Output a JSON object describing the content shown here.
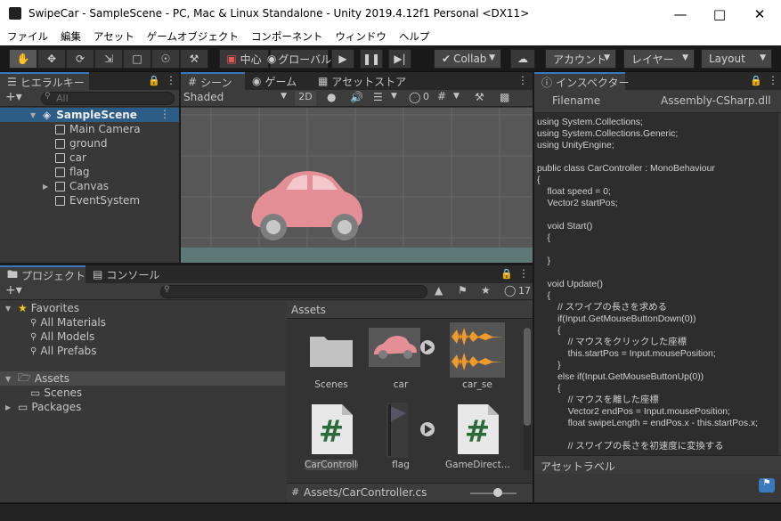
{
  "window": {
    "title": "SwipeCar - SampleScene - PC, Mac & Linux Standalone - Unity 2019.4.12f1 Personal <DX11>"
  },
  "menu": [
    "ファイル",
    "編集",
    "アセット",
    "ゲームオブジェクト",
    "コンポーネント",
    "ウィンドウ",
    "ヘルプ"
  ],
  "toolbar": {
    "pivot_label": "中心",
    "global_label": "グローバル",
    "collab_label": "Collab",
    "account_label": "アカウント",
    "layers_label": "レイヤー",
    "layout_label": "Layout"
  },
  "hierarchy": {
    "tab_label": "ヒエラルキー",
    "search_placeholder": "All",
    "scene_name": "SampleScene",
    "items": [
      "Main Camera",
      "ground",
      "car",
      "flag",
      "Canvas",
      "EventSystem"
    ]
  },
  "scene": {
    "tabs": [
      "シーン",
      "ゲーム",
      "アセットストア"
    ],
    "shading_mode": "Shaded",
    "mode_2d": "2D",
    "hidden_count": "0",
    "car_color": "#e48f96"
  },
  "inspector": {
    "tab_label": "インスペクター",
    "filename_label": "Filename",
    "filename_value": "Assembly-CSharp.dll",
    "code": [
      "using System.Collections;",
      "using System.Collections.Generic;",
      "using UnityEngine;",
      "",
      "public class CarController : MonoBehaviour",
      "{",
      "    float speed = 0;",
      "    Vector2 startPos;",
      "",
      "    void Start()",
      "    {",
      "",
      "    }",
      "",
      "    void Update()",
      "    {",
      "        // スワイプの長さを求める",
      "        if(Input.GetMouseButtonDown(0))",
      "        {",
      "            // マウスをクリックした座標",
      "            this.startPos = Input.mousePosition;",
      "        }",
      "        else if(Input.GetMouseButtonUp(0))",
      "        {",
      "            // マウスを離した座標",
      "            Vector2 endPos = Input.mousePosition;",
      "            float swipeLength = endPos.x - this.startPos.x;",
      "",
      "            // スワイプの長さを初速度に変換する"
    ],
    "asset_labels": "アセットラベル"
  },
  "project": {
    "tabs": [
      "プロジェクト",
      "コンソール"
    ],
    "hidden_count": "17",
    "favorites_label": "Favorites",
    "favorites": [
      "All Materials",
      "All Models",
      "All Prefabs"
    ],
    "assets_label": "Assets",
    "asset_folders": [
      "Scenes"
    ],
    "packages_label": "Packages",
    "breadcrumb": "Assets",
    "assets": [
      "Scenes",
      "car",
      "car_se",
      "CarController",
      "flag",
      "GameDirect..."
    ],
    "footer_path": "Assets/CarController.cs"
  }
}
